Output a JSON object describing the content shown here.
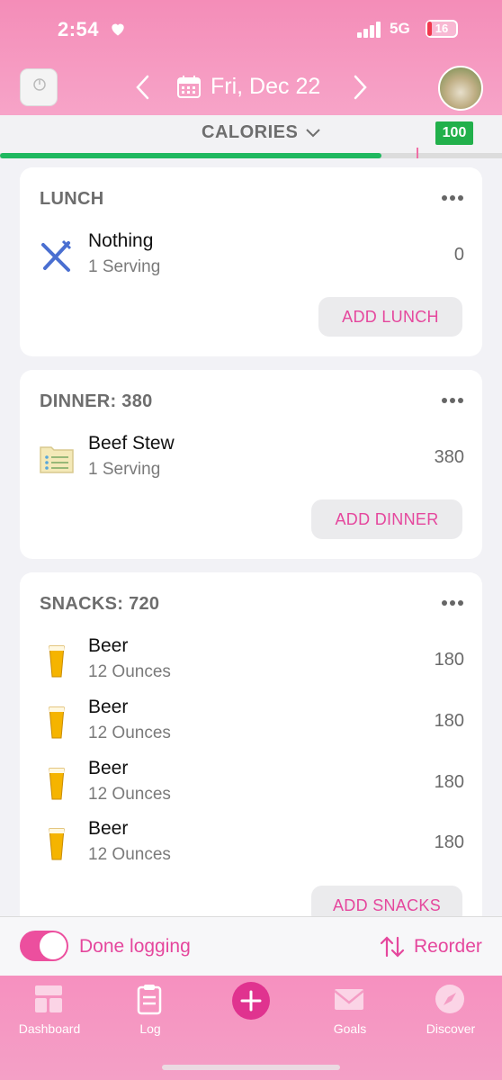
{
  "status_bar": {
    "time": "2:54",
    "network": "5G",
    "battery": "16",
    "battery_level": 0.16
  },
  "header": {
    "date": "Fri, Dec 22"
  },
  "calories": {
    "title": "CALORIES",
    "badge": "100",
    "progress": 0.76,
    "colors": {
      "progress": "#1fb85f",
      "badge": "#22b04b"
    }
  },
  "meals": {
    "lunch": {
      "title": "LUNCH",
      "items": [
        {
          "name": "Nothing",
          "serving": "1 Serving",
          "value": "0",
          "icon": "fork-knife-icon"
        }
      ],
      "add_label": "ADD LUNCH"
    },
    "dinner": {
      "title": "DINNER: 380",
      "items": [
        {
          "name": "Beef Stew",
          "serving": "1 Serving",
          "value": "380",
          "icon": "recipe-folder-icon"
        }
      ],
      "add_label": "ADD DINNER"
    },
    "snacks": {
      "title": "SNACKS: 720",
      "items": [
        {
          "name": "Beer",
          "serving": "12 Ounces",
          "value": "180",
          "icon": "beer-glass-icon"
        },
        {
          "name": "Beer",
          "serving": "12 Ounces",
          "value": "180",
          "icon": "beer-glass-icon"
        },
        {
          "name": "Beer",
          "serving": "12 Ounces",
          "value": "180",
          "icon": "beer-glass-icon"
        },
        {
          "name": "Beer",
          "serving": "12 Ounces",
          "value": "180",
          "icon": "beer-glass-icon"
        }
      ],
      "add_label": "ADD SNACKS"
    }
  },
  "footer": {
    "done_label": "Done logging",
    "reorder_label": "Reorder",
    "done_toggle_on": true
  },
  "tabs": [
    {
      "label": "Dashboard",
      "icon": "dashboard-icon"
    },
    {
      "label": "Log",
      "icon": "log-clipboard-icon"
    },
    {
      "label": "",
      "icon": "plus-icon"
    },
    {
      "label": "Goals",
      "icon": "goals-envelope-icon"
    },
    {
      "label": "Discover",
      "icon": "compass-icon"
    }
  ],
  "colors": {
    "accent": "#e5479d",
    "header": "#f48db8"
  }
}
